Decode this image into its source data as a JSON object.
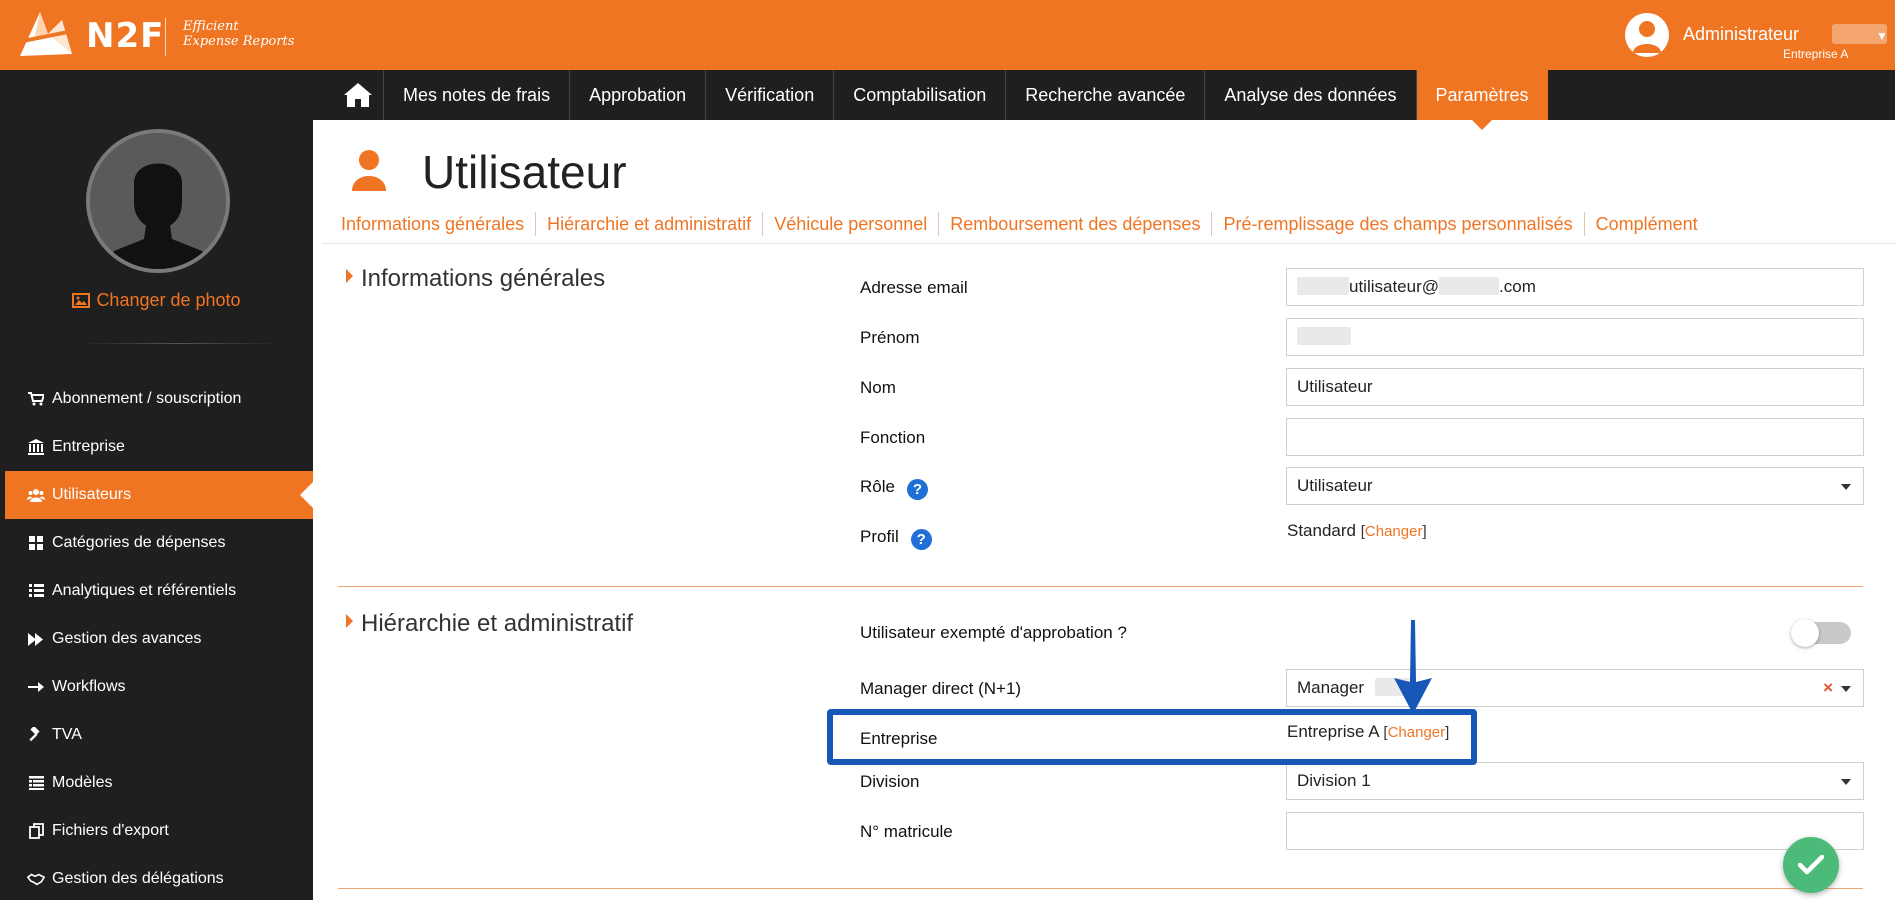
{
  "brand": {
    "name": "N2F",
    "tagline_line1": "Efficient",
    "tagline_line2": "Expense Reports"
  },
  "user": {
    "name": "Administrateur",
    "company": "Entreprise A"
  },
  "main_nav": {
    "items": [
      "Mes notes de frais",
      "Approbation",
      "Vérification",
      "Comptabilisation",
      "Recherche avancée",
      "Analyse des données",
      "Paramètres"
    ],
    "active": "Paramètres"
  },
  "sidebar": {
    "change_photo": "Changer de photo",
    "items": [
      {
        "label": "Abonnement / souscription",
        "icon": "cart-icon"
      },
      {
        "label": "Entreprise",
        "icon": "bank-icon"
      },
      {
        "label": "Utilisateurs",
        "icon": "users-icon",
        "active": true
      },
      {
        "label": "Catégories de dépenses",
        "icon": "grid-icon"
      },
      {
        "label": "Analytiques et référentiels",
        "icon": "list-icon"
      },
      {
        "label": "Gestion des avances",
        "icon": "fast-forward-icon"
      },
      {
        "label": "Workflows",
        "icon": "arrow-right-icon"
      },
      {
        "label": "TVA",
        "icon": "gavel-icon"
      },
      {
        "label": "Modèles",
        "icon": "template-list-icon"
      },
      {
        "label": "Fichiers d'export",
        "icon": "copy-icon"
      },
      {
        "label": "Gestion des délégations",
        "icon": "handshake-icon"
      }
    ]
  },
  "page": {
    "title": "Utilisateur",
    "subtabs": [
      "Informations générales",
      "Hiérarchie et administratif",
      "Véhicule personnel",
      "Remboursement des dépenses",
      "Pré-remplissage des champs personnalisés",
      "Complément"
    ]
  },
  "general": {
    "section_title": "Informations générales",
    "email_label": "Adresse email",
    "email_value_local": "utilisateur@",
    "email_value_tld": ".com",
    "firstname_label": "Prénom",
    "lastname_label": "Nom",
    "lastname_value": "Utilisateur",
    "function_label": "Fonction",
    "function_value": "",
    "role_label": "Rôle",
    "role_value": "Utilisateur",
    "profile_label": "Profil",
    "profile_value": "Standard",
    "change_link": "Changer"
  },
  "hierarchy": {
    "section_title": "Hiérarchie et administratif",
    "exempt_label": "Utilisateur exempté d'approbation ?",
    "exempt_on": false,
    "manager_label": "Manager direct (N+1)",
    "manager_value": "Manager",
    "company_label": "Entreprise",
    "company_value": "Entreprise A",
    "change_link": "Changer",
    "division_label": "Division",
    "division_value": "Division 1",
    "matricule_label": "N° matricule",
    "matricule_value": ""
  },
  "colors": {
    "brand_orange": "#f07523",
    "nav_dark": "#1f1f1f",
    "highlight_blue": "#1757b8",
    "help_blue": "#1f6fd6",
    "save_green": "#4cbb7a"
  }
}
